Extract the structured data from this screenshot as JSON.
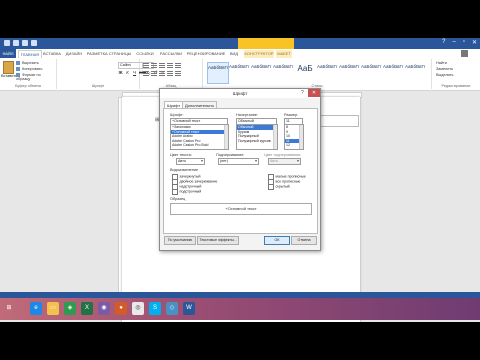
{
  "window": {
    "title": "",
    "context_tab": "",
    "user": ""
  },
  "ribbon": {
    "tabs": [
      "ФАЙЛ",
      "ГЛАВНАЯ",
      "ВСТАВКА",
      "ДИЗАЙН",
      "РАЗМЕТКА СТРАНИЦЫ",
      "ССЫЛКИ",
      "РАССЫЛКИ",
      "РЕЦЕНЗИРОВАНИЕ",
      "ВИД",
      "КОНСТРУКТОР",
      "МАКЕТ"
    ],
    "paste_label": "Вставить",
    "clipboard_cmds": [
      "Вырезать",
      "Копировать",
      "Формат по образцу"
    ],
    "font_name": "Calibri",
    "font_size": "",
    "style_sample": "АаБбВвГг",
    "style_sample_large": "АаБ",
    "styles": [
      "",
      "",
      "",
      "",
      "",
      "",
      "",
      "",
      "",
      "",
      "",
      ""
    ],
    "editing_cmds": [
      "Найти",
      "Заменить",
      "Выделить"
    ],
    "groups": [
      "Буфер обмена",
      "Шрифт",
      "Абзац",
      "Стили",
      "Редактирование"
    ]
  },
  "dialog": {
    "title": "Шрифт",
    "close": "✕",
    "help": "?",
    "tabs": [
      "Шрифт",
      "Дополнительно"
    ],
    "font_label": "Шрифт:",
    "font_value": "+Основной текст",
    "font_list": [
      "+Заголовки",
      "+Основной текст",
      "Adobe Arabic",
      "Adobe Caslon Pro",
      "Adobe Caslon Pro Bold"
    ],
    "style_label": "Начертание:",
    "style_value": "Обычный",
    "style_list": [
      "Обычный",
      "Курсив",
      "Полужирный",
      "Полужирный курсив"
    ],
    "size_label": "Размер:",
    "size_value": "11",
    "size_list": [
      "8",
      "9",
      "10",
      "11",
      "12"
    ],
    "color_label": "Цвет текста:",
    "color_value": "Авто",
    "underline_label": "Подчеркивание:",
    "underline_value": "(нет)",
    "underline_color_label": "Цвет подчеркивания:",
    "underline_color_value": "Авто",
    "effects_label": "Видоизменение",
    "effects_left": [
      "зачеркнутый",
      "двойное зачеркивание",
      "надстрочный",
      "подстрочный"
    ],
    "effects_right": [
      "малые прописные",
      "все прописные",
      "скрытый"
    ],
    "preview_label": "Образец",
    "preview_text": "+Основной текст",
    "note": "",
    "buttons": [
      "По умолчанию",
      "Текстовые эффекты...",
      "ОК",
      "Отмена"
    ]
  },
  "statusbar": {
    "page": "",
    "words": "",
    "lang": "",
    "zoom": ""
  },
  "taskbar": {
    "icons": [
      "start-icon",
      "ie-icon",
      "explorer-icon",
      "store-icon",
      "excel-icon",
      "app-icon",
      "app-icon-2",
      "chrome-icon",
      "skype-icon",
      "paint-icon",
      "word-icon"
    ],
    "glyphs": [
      "⊞",
      "e",
      "▭",
      "◈",
      "X",
      "◉",
      "●",
      "◎",
      "S",
      "◇",
      "W"
    ],
    "time": "",
    "date": ""
  },
  "colors": {
    "word_blue": "#2b579a",
    "context_yellow": "#f7c325",
    "close_red": "#c75050",
    "selection_blue": "#3d7ad6"
  }
}
